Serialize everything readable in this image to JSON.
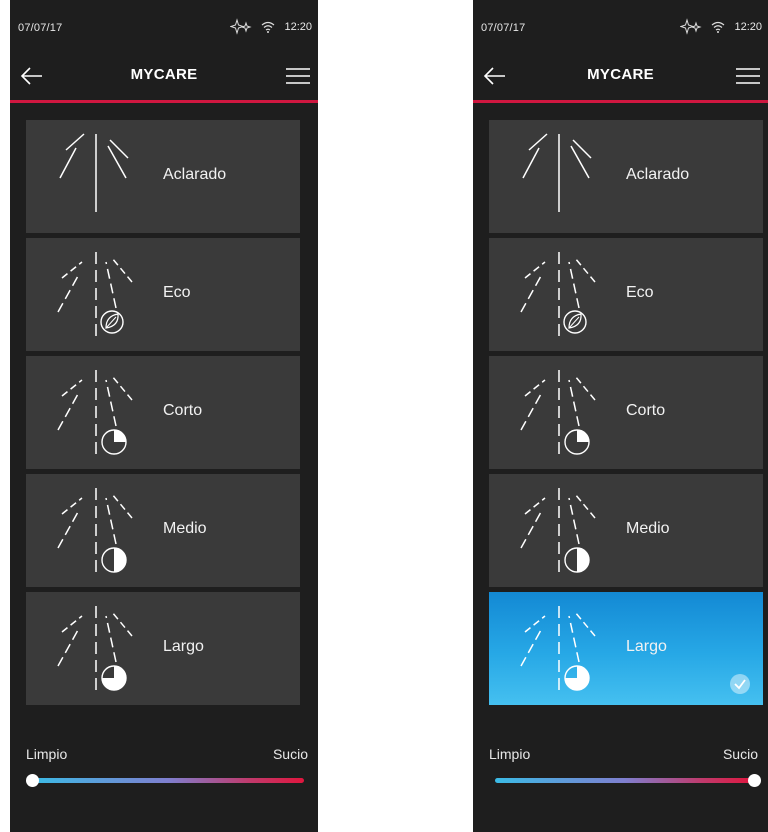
{
  "screens": [
    {
      "status": {
        "date": "07/07/17",
        "time": "12:20"
      },
      "header": {
        "title": "MYCARE"
      },
      "programs": [
        {
          "label": "Aclarado",
          "icon": "spray-rinse-icon",
          "selected": false
        },
        {
          "label": "Eco",
          "icon": "spray-eco-leaf-icon",
          "selected": false
        },
        {
          "label": "Corto",
          "icon": "spray-clock-short-icon",
          "selected": false
        },
        {
          "label": "Medio",
          "icon": "spray-clock-medium-icon",
          "selected": false
        },
        {
          "label": "Largo",
          "icon": "spray-clock-long-icon",
          "selected": false
        }
      ],
      "slider": {
        "min_label": "Limpio",
        "max_label": "Sucio",
        "value": 0.0
      }
    },
    {
      "status": {
        "date": "07/07/17",
        "time": "12:20"
      },
      "header": {
        "title": "MYCARE"
      },
      "programs": [
        {
          "label": "Aclarado",
          "icon": "spray-rinse-icon",
          "selected": false
        },
        {
          "label": "Eco",
          "icon": "spray-eco-leaf-icon",
          "selected": false
        },
        {
          "label": "Corto",
          "icon": "spray-clock-short-icon",
          "selected": false
        },
        {
          "label": "Medio",
          "icon": "spray-clock-medium-icon",
          "selected": false
        },
        {
          "label": "Largo",
          "icon": "spray-clock-long-icon",
          "selected": true
        }
      ],
      "slider": {
        "min_label": "Limpio",
        "max_label": "Sucio",
        "value": 1.0
      }
    }
  ],
  "colors": {
    "background": "#1e1e1e",
    "card": "#3a3a3a",
    "accent_red": "#d01740",
    "selected_blue": "#1e9ee0",
    "slider_start": "#3bbbe6",
    "slider_end": "#e0163e"
  }
}
